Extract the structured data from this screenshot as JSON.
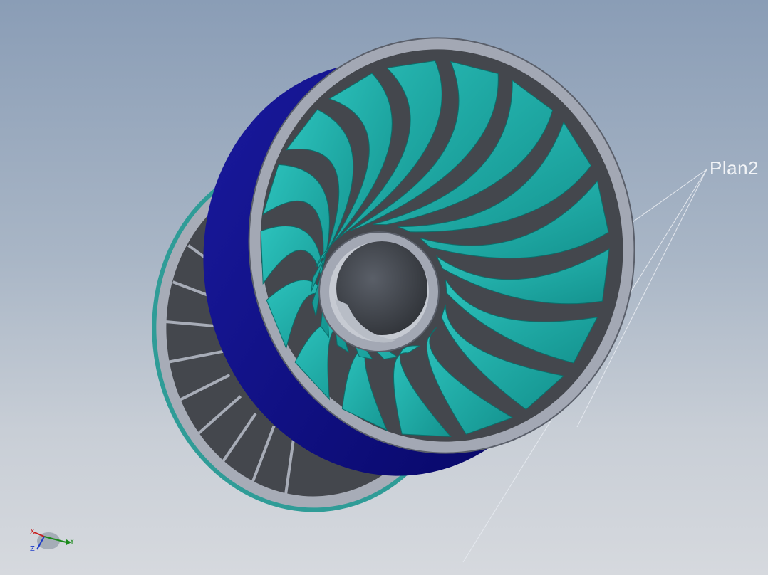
{
  "viewport": {
    "model": "turbine-runner",
    "colors": {
      "background_top": "#8a9db6",
      "background_bottom": "#d6d9de",
      "blade": "#1fb0ab",
      "blade_shadow": "#0e7f7c",
      "band": "#0a0a8a",
      "shroud": "#a3a8b4",
      "hub_shadow": "#3f4248"
    }
  },
  "annotation": {
    "plane_label": "Plan2"
  },
  "triad": {
    "x_label": "X",
    "y_label": "Y",
    "z_label": "Z"
  }
}
